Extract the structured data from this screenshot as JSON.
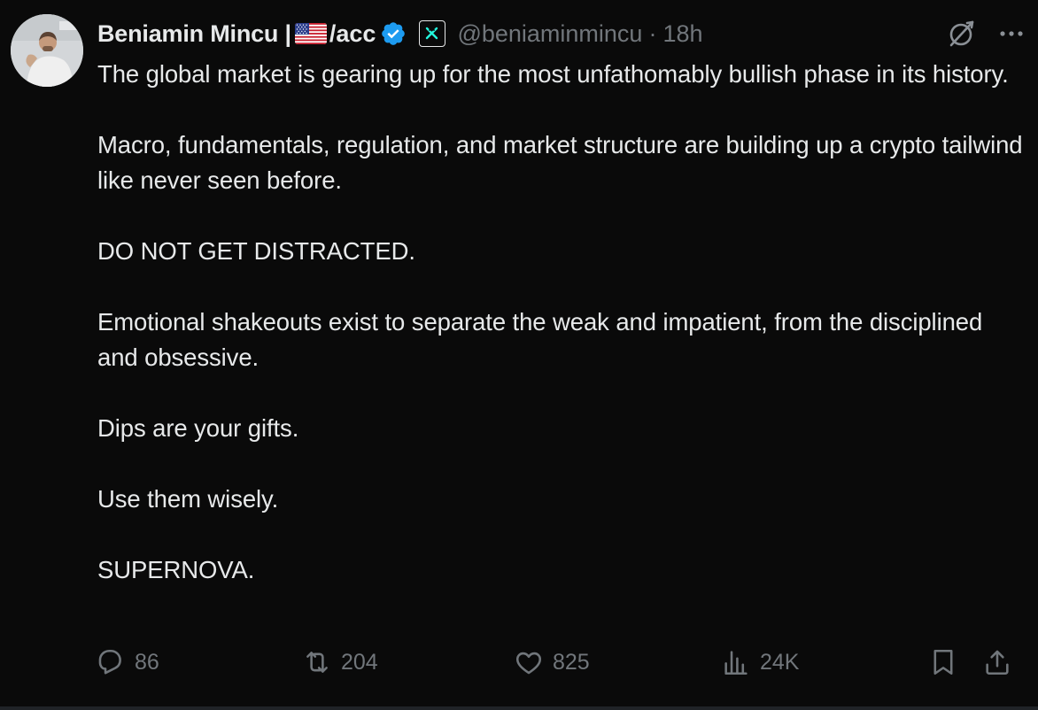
{
  "author": {
    "display_name": "Beniamin Mincu |",
    "name_suffix": "/acc",
    "handle": "@beniaminmincu",
    "separator": "·",
    "time": "18h",
    "flag": "us-flag-icon",
    "verified": "verified-badge-icon",
    "affiliation": "multiversx-logo-icon"
  },
  "tweet": {
    "paragraphs": [
      "The global market is gearing up for the most unfathomably bullish phase in its history.",
      "Macro, fundamentals, regulation, and market structure are building up a crypto tailwind like never seen before.",
      "DO NOT GET DISTRACTED.",
      "Emotional shakeouts exist to separate the weak and impatient, from the disciplined and obsessive.",
      "Dips are your gifts.",
      "Use them wisely.",
      "SUPERNOVA."
    ]
  },
  "actions": {
    "replies": "86",
    "reposts": "204",
    "likes": "825",
    "views": "24K"
  },
  "colors": {
    "background": "#0a0a0a",
    "text": "#e7e9ea",
    "muted": "#71767b",
    "verified": "#1d9bf0",
    "affiliation_accent": "#23f7dd"
  }
}
